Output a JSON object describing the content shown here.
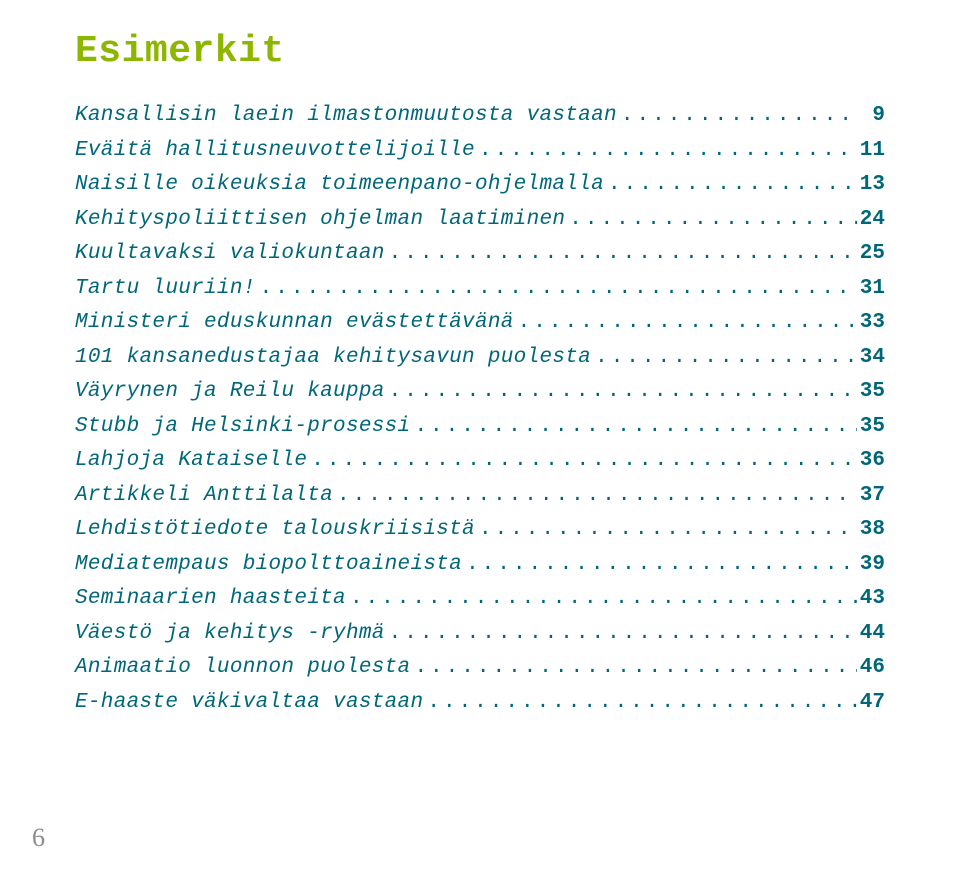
{
  "title": "Esimerkit",
  "toc": [
    {
      "label": "Kansallisin laein ilmastonmuutosta vastaan",
      "page": "9"
    },
    {
      "label": "Eväitä hallitusneuvottelijoille",
      "page": "11"
    },
    {
      "label": "Naisille oikeuksia toimeenpano-ohjelmalla",
      "page": "13"
    },
    {
      "label": "Kehityspoliittisen ohjelman laatiminen",
      "page": "24"
    },
    {
      "label": "Kuultavaksi valiokuntaan",
      "page": "25"
    },
    {
      "label": "Tartu luuriin!",
      "page": "31"
    },
    {
      "label": "Ministeri eduskunnan evästettävänä",
      "page": "33"
    },
    {
      "label": "101 kansanedustajaa kehitysavun puolesta",
      "page": "34"
    },
    {
      "label": "Väyrynen ja Reilu kauppa",
      "page": "35"
    },
    {
      "label": "Stubb ja Helsinki-prosessi",
      "page": "35"
    },
    {
      "label": "Lahjoja Kataiselle",
      "page": "36"
    },
    {
      "label": "Artikkeli Anttilalta",
      "page": "37"
    },
    {
      "label": "Lehdistötiedote talouskriisistä",
      "page": "38"
    },
    {
      "label": "Mediatempaus biopolttoaineista",
      "page": "39"
    },
    {
      "label": "Seminaarien haasteita",
      "page": "43"
    },
    {
      "label": "Väestö ja kehitys -ryhmä",
      "page": "44"
    },
    {
      "label": "Animaatio luonnon puolesta",
      "page": "46"
    },
    {
      "label": "E-haaste väkivaltaa vastaan",
      "page": "47"
    }
  ],
  "footer_page": "6"
}
